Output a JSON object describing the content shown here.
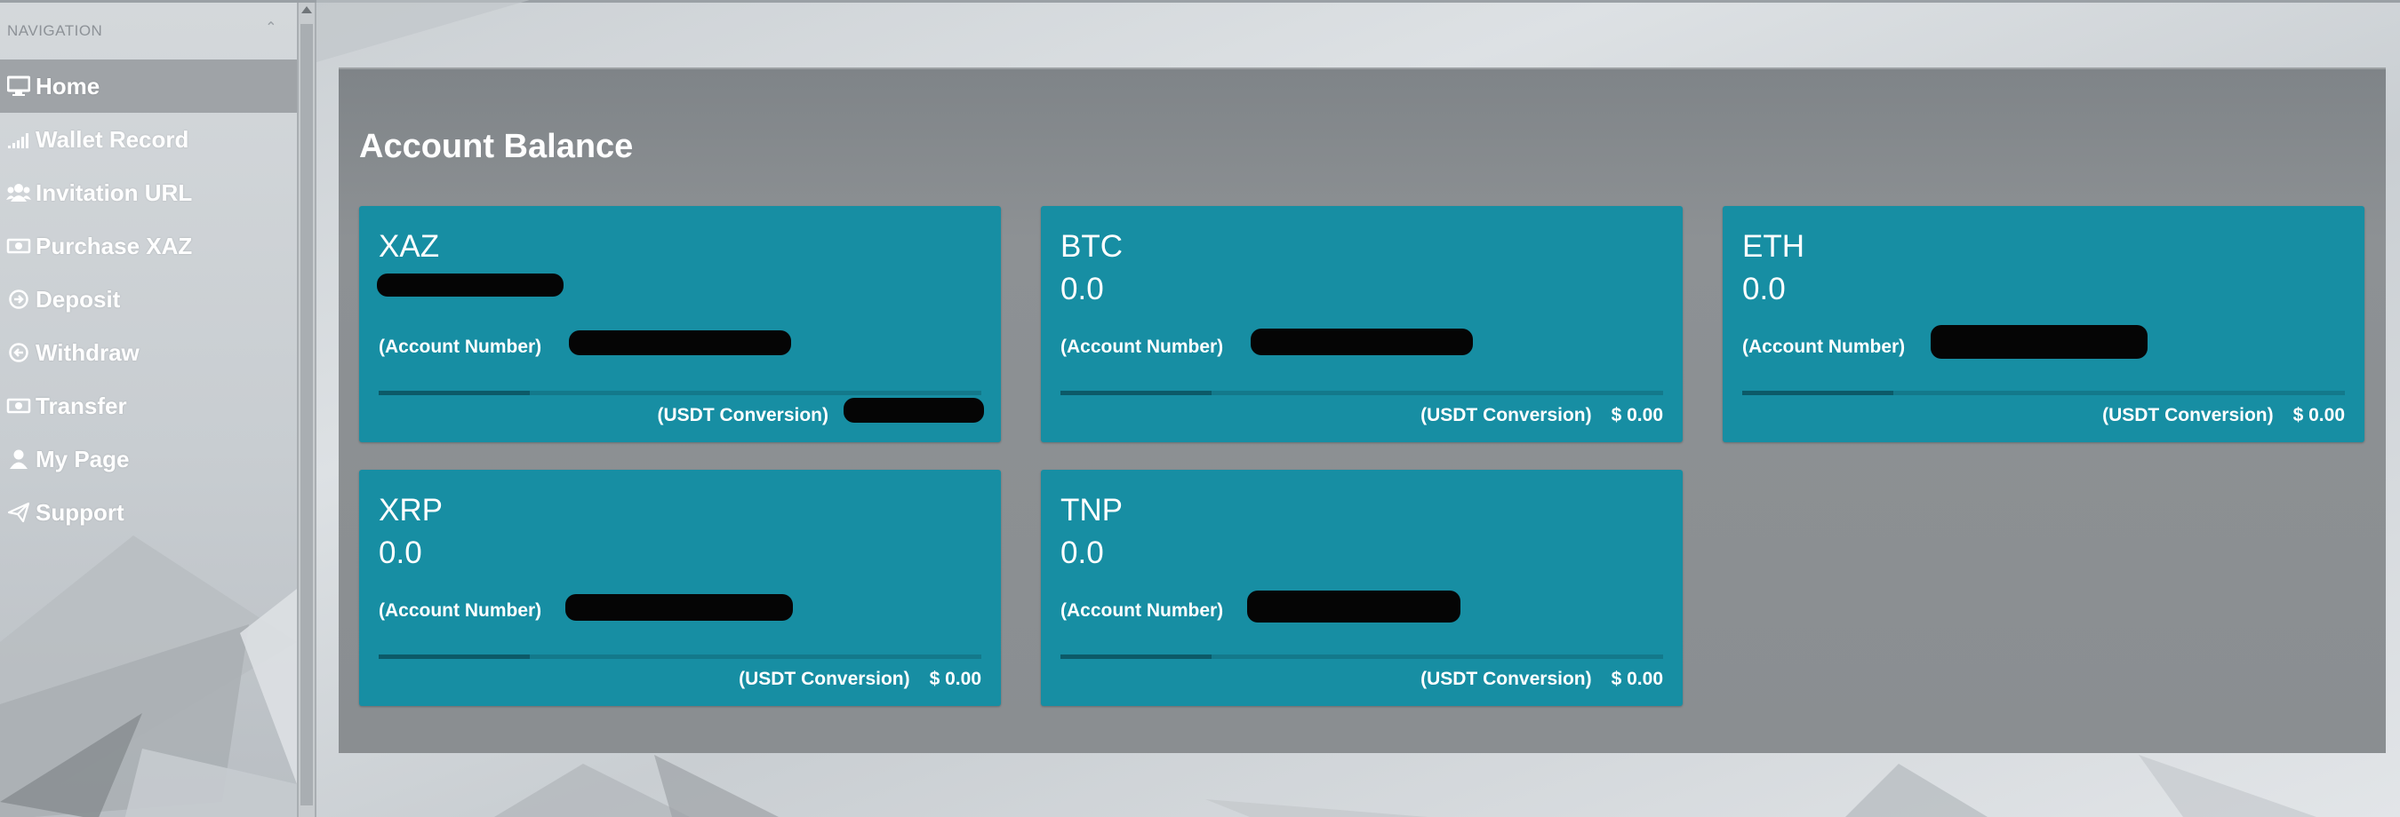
{
  "sidebar": {
    "header": "NAVIGATION",
    "items": [
      {
        "label": "Home",
        "icon": "monitor-icon",
        "active": true
      },
      {
        "label": "Wallet Record",
        "icon": "signal-bars-icon"
      },
      {
        "label": "Invitation URL",
        "icon": "users-icon"
      },
      {
        "label": "Purchase XAZ",
        "icon": "money-icon"
      },
      {
        "label": "Deposit",
        "icon": "circle-arrow-right-icon"
      },
      {
        "label": "Withdraw",
        "icon": "circle-arrow-left-icon"
      },
      {
        "label": "Transfer",
        "icon": "money-icon"
      },
      {
        "label": "My Page",
        "icon": "user-icon"
      },
      {
        "label": "Support",
        "icon": "paper-plane-icon"
      }
    ]
  },
  "main": {
    "title": "Account Balance",
    "account_label": "(Account Number)",
    "conversion_label": "(USDT Conversion)",
    "cards": [
      {
        "coin": "XAZ",
        "amount": "",
        "conversion": "",
        "progress": 0.25
      },
      {
        "coin": "BTC",
        "amount": "0.0",
        "conversion": "$ 0.00",
        "progress": 0.25
      },
      {
        "coin": "ETH",
        "amount": "0.0",
        "conversion": "$ 0.00",
        "progress": 0.25
      },
      {
        "coin": "XRP",
        "amount": "0.0",
        "conversion": "$ 0.00",
        "progress": 0.25
      },
      {
        "coin": "TNP",
        "amount": "0.0",
        "conversion": "$ 0.00",
        "progress": 0.25
      }
    ]
  },
  "colors": {
    "card": "#178ea3",
    "panel": "#888c90",
    "active_nav": "#9fa3a7"
  }
}
